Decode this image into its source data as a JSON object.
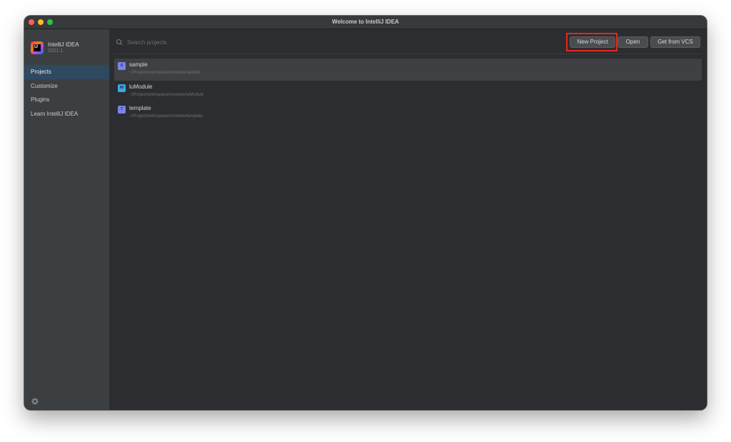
{
  "window": {
    "title": "Welcome to IntelliJ IDEA"
  },
  "brand": {
    "name": "IntelliJ IDEA",
    "version": "2021.1",
    "logo_text": "IJ"
  },
  "sidebar": {
    "items": [
      {
        "label": "Projects",
        "active": true
      },
      {
        "label": "Customize",
        "active": false
      },
      {
        "label": "Plugins",
        "active": false
      },
      {
        "label": "Learn IntelliJ IDEA",
        "active": false
      }
    ],
    "settings_icon": "gear-icon"
  },
  "search": {
    "placeholder": "Search projects",
    "value": ""
  },
  "toolbar": {
    "new_project_label": "New Project",
    "open_label": "Open",
    "vcs_label": "Get from VCS"
  },
  "annotation": {
    "color": "#e8261c",
    "target": "New Project"
  },
  "projects": [
    {
      "icon_letter": "S",
      "icon_color": "#7b83ea",
      "name": "sample",
      "path": "~/Project/workspace/rnnotree/sample",
      "selected": true
    },
    {
      "icon_letter": "IM",
      "icon_color": "#3ca7e6",
      "name": "luModule",
      "path": "~/Project/workspace/rnnotree/luModule",
      "selected": false
    },
    {
      "icon_letter": "T",
      "icon_color": "#7b83ea",
      "name": "template",
      "path": "~/Project/workspace/rnnotree/template",
      "selected": false
    }
  ],
  "colors": {
    "sidebar_bg": "#3c3f41",
    "main_bg": "#2b2d30",
    "active_nav": "#2f4960",
    "selected_row": "#3e4043"
  }
}
